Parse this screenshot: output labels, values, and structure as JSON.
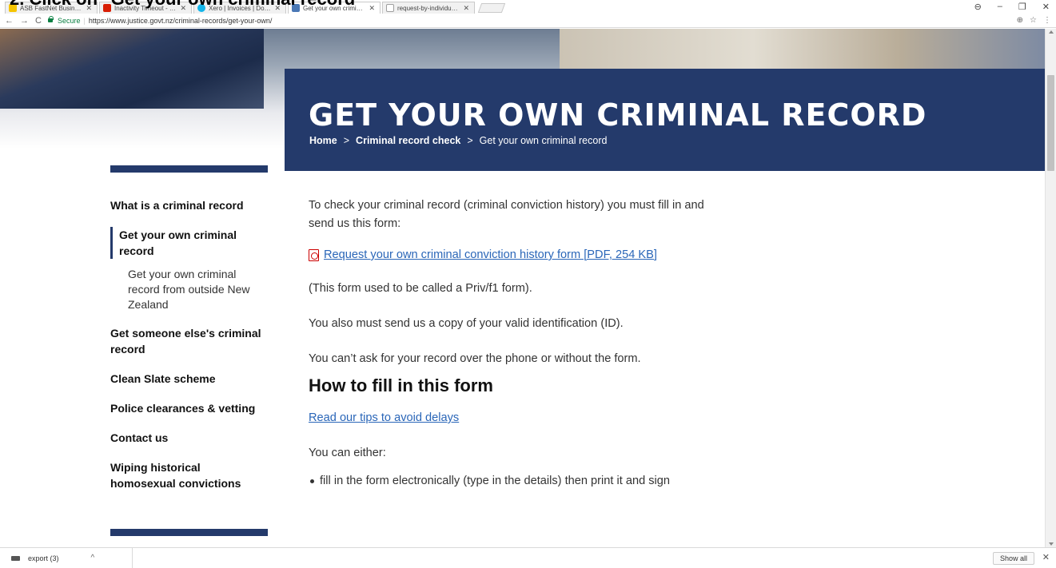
{
  "caption": "2. Click on \"Get your own criminal record\"",
  "browser": {
    "tabs": [
      {
        "title": "ASB FastNet Business",
        "fav_color": "#f5c400",
        "active": false
      },
      {
        "title": "Inactivity Timeout - Wes",
        "fav_color": "#d81e05",
        "active": false
      },
      {
        "title": "Xero | Invoices | Downie",
        "fav_color": "#13b5ea",
        "active": false
      },
      {
        "title": "Get your own criminal re",
        "fav_color": "#4a78b5",
        "active": true
      },
      {
        "title": "request-by-individual.pc",
        "fav_color": "#9e9e9e",
        "active": false
      }
    ],
    "secure_label": "Secure",
    "url": "https://www.justice.govt.nz/criminal-records/get-your-own/"
  },
  "banner": {
    "title": "GET YOUR OWN CRIMINAL RECORD",
    "crumbs": [
      "Home",
      "Criminal record check",
      "Get your own criminal record"
    ],
    "crumb_sep": ">"
  },
  "sidenav": {
    "items": [
      "What is a criminal record",
      "Get your own criminal record",
      "Get your own criminal record from outside New Zealand",
      "Get someone else's criminal record",
      "Clean Slate scheme",
      "Police clearances & vetting",
      "Contact us",
      "Wiping historical homosexual convictions"
    ]
  },
  "main": {
    "intro": "To check your criminal record (criminal conviction history) you must fill in and send us this form:",
    "pdf_link": "Request your own criminal conviction history form [PDF, 254 KB]",
    "p_priv": "(This form used to be called a Priv/f1 form).",
    "p_id": "You also must send us a copy of your valid identification (ID).",
    "p_phone": "You can’t ask for your record over the phone or without the form.",
    "heading": "How to fill in this form",
    "tips_link": "Read our tips to avoid delays",
    "p_either": "You can either:",
    "bullet1": "fill in the form electronically (type in the details) then print it and sign"
  },
  "downloads": {
    "file": "export (3)",
    "show_all": "Show all"
  },
  "colors": {
    "brand_navy": "#243a6b",
    "link": "#2a66b8"
  }
}
